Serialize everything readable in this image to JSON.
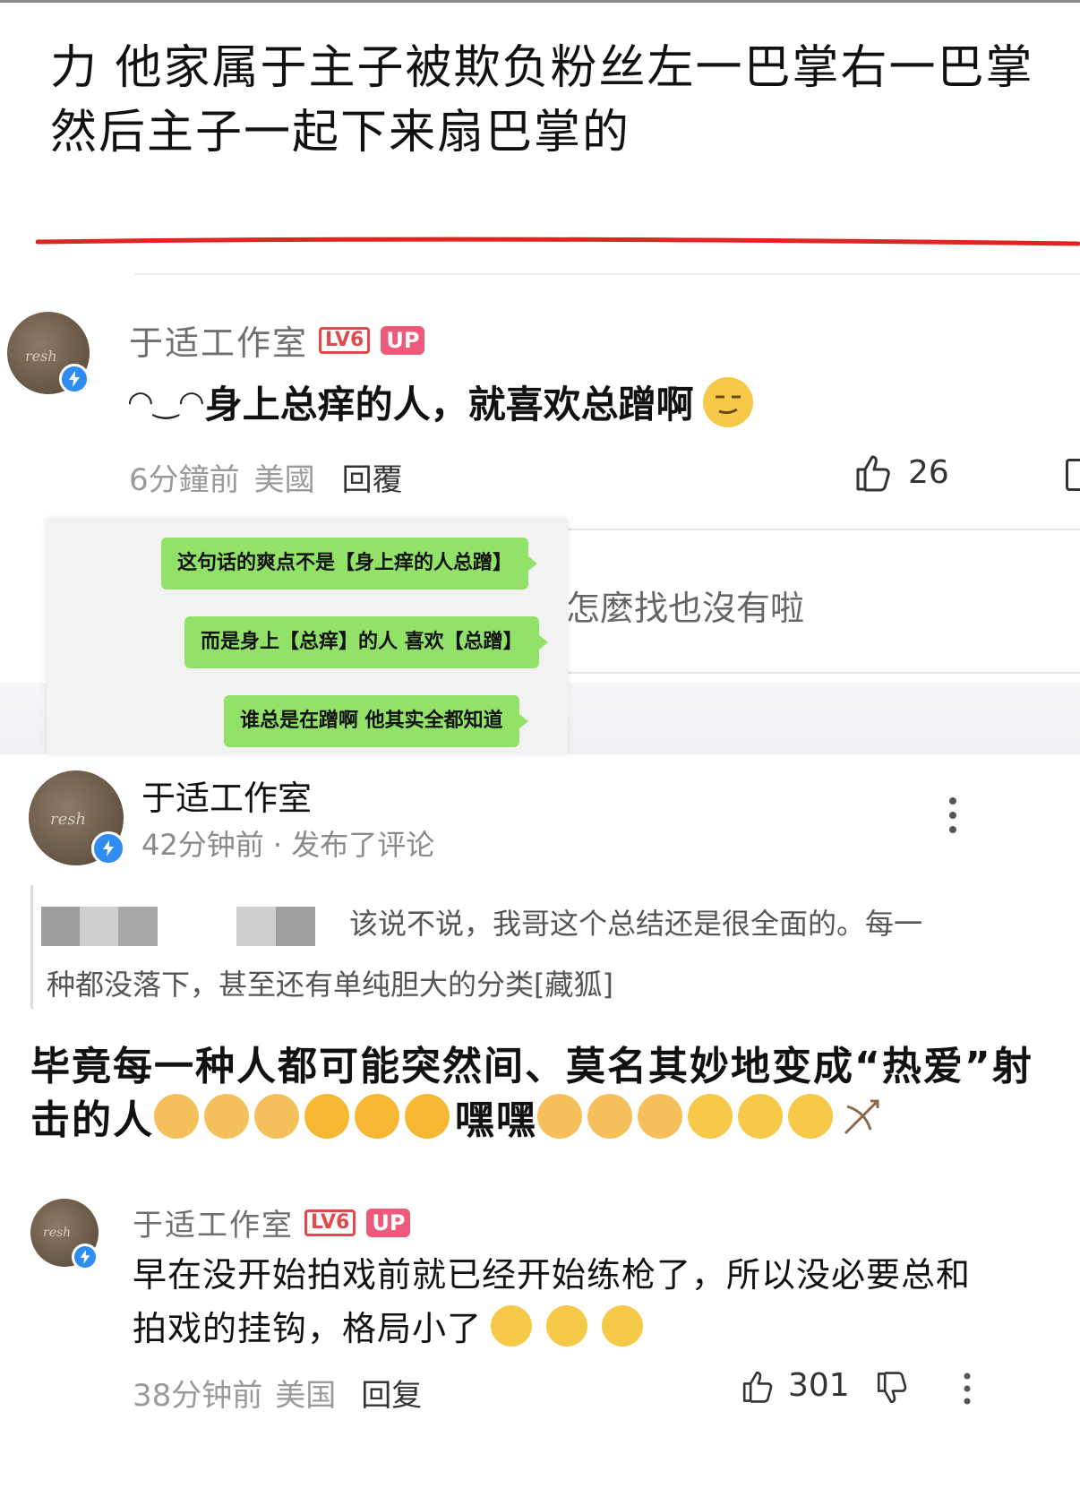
{
  "headline": "力 他家属于主子被欺负粉丝左一巴掌右一巴掌然后主子一起下来扇巴掌的",
  "comment1": {
    "username": "于适工作室",
    "level_badge": "LV6",
    "up_badge": "UP",
    "kaomoji": "◠‿◠",
    "text": "身上总痒的人，就喜欢总蹭啊",
    "emoji": "smirk-emoji",
    "time": "6分鐘前",
    "location": "美國",
    "reply_label": "回覆",
    "like_count": "26"
  },
  "chat": {
    "bubbles": [
      "这句话的爽点不是【身上痒的人总蹭】",
      "而是身上【总痒】的人  喜欢【总蹭】",
      "谁总是在蹭啊  他其实全都知道"
    ],
    "behind_text": "怎麼找也沒有啦"
  },
  "post": {
    "username": "于适工作室",
    "time": "42分钟前",
    "action": "· 发布了评论",
    "more_icon": "more-vertical-icon",
    "quote_line1": "该说不说，我哥这个总结还是很全面的。每一",
    "quote_line2": "种都没落下，甚至还有单纯胆大的分类[藏狐]",
    "body_line1": "毕竟每一种人都可能突然间、莫名其妙地变成“热爱”射",
    "body_line2_prefix": "击的人",
    "body_line2_mid": "嘿嘿"
  },
  "comment3": {
    "username": "于适工作室",
    "level_badge": "LV6",
    "up_badge": "UP",
    "text_line1": "早在没开始拍戏前就已经开始练枪了，所以没必要总和",
    "text_line2": "拍戏的挂钩，格局小了",
    "time": "38分钟前",
    "location": "美国",
    "reply_label": "回复",
    "like_count": "301"
  },
  "colors": {
    "underline_red": "#e0241f",
    "bubble_green": "#92e26a",
    "verified_blue": "#2f8cf0",
    "up_pink": "#ee5a7c",
    "level_red": "#e2484b"
  }
}
